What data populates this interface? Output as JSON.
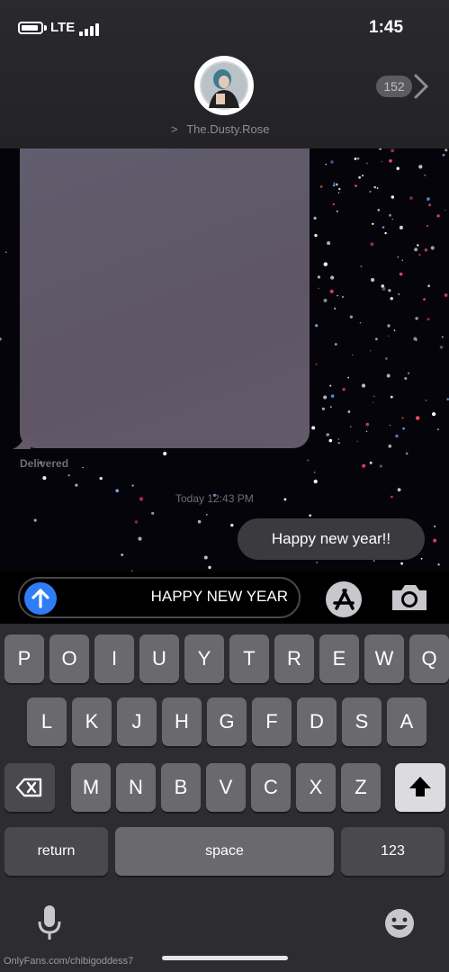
{
  "status_bar": {
    "time": "1:45",
    "network": "LTE"
  },
  "header": {
    "contact_name": "The.Dusty.Rose",
    "contact_chevron": ">",
    "back_count": "152"
  },
  "chat": {
    "delivered_label": "Delivered",
    "timestamp": "Today 12:43 PM",
    "message_text": "Happy new year!!"
  },
  "input": {
    "value": "HAPPY NEW YEAR"
  },
  "keyboard": {
    "row1": [
      "P",
      "O",
      "I",
      "U",
      "Y",
      "T",
      "R",
      "E",
      "W",
      "Q"
    ],
    "row2": [
      "L",
      "K",
      "J",
      "H",
      "G",
      "F",
      "D",
      "S",
      "A"
    ],
    "row3": [
      "M",
      "N",
      "B",
      "V",
      "C",
      "X",
      "Z"
    ],
    "return_label": "return",
    "space_label": "space",
    "numbers_label": "123"
  },
  "footer": {
    "watermark": "OnlyFans.com/chibigoddess7"
  },
  "colors": {
    "send_accent": "#2f7df6",
    "bubble": "#3b3b3f",
    "keyboard_bg": "#2d2d30"
  },
  "icons": [
    "battery-icon",
    "signal-icon",
    "back-chevron-icon",
    "camera-icon",
    "appstore-icon",
    "send-arrow-icon",
    "delete-icon",
    "shift-icon",
    "mic-icon",
    "emoji-icon"
  ]
}
